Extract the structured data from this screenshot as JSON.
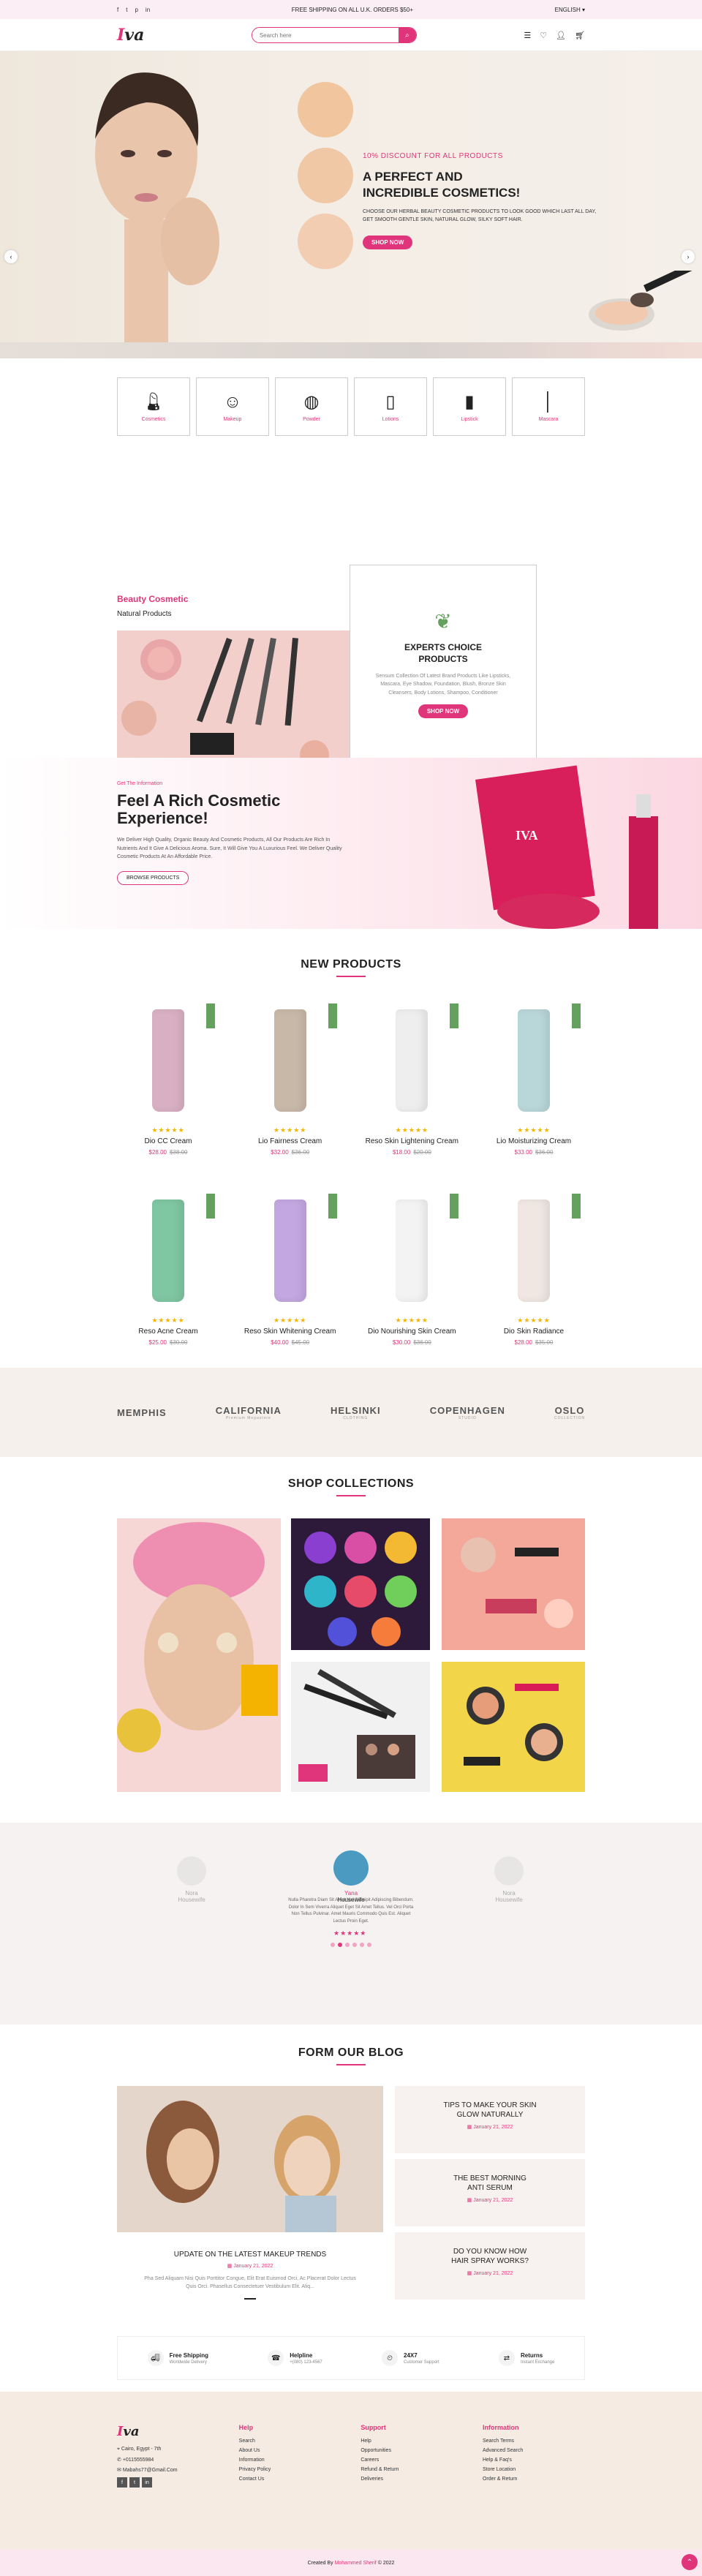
{
  "topbar": {
    "announcement": "FREE SHIPPING ON ALL U.K. ORDERS $50+",
    "language": "ENGLISH",
    "social_icons": [
      "facebook-icon",
      "twitter-icon",
      "pinterest-icon",
      "linkedin-icon"
    ]
  },
  "header": {
    "logo": "Iva",
    "search_placeholder": "Search here",
    "icons": [
      "grid-icon",
      "heart-icon",
      "user-icon",
      "cart-icon"
    ]
  },
  "hero": {
    "subtitle": "10% DISCOUNT FOR ALL PRODUCTS",
    "title_line1": "A PERFECT AND",
    "title_line2": "INCREDIBLE COSMETICS!",
    "text": "CHOOSE OUR HERBAL BEAUTY COSMETIC PRODUCTS TO LOOK GOOD WHICH LAST ALL DAY, GET SMOOTH GENTLE SKIN, NATURAL GLOW, SILKY SOFT HAIR.",
    "button": "SHOP NOW"
  },
  "categories": [
    {
      "label": "Cosmetics",
      "icon": "cosmetics-icon"
    },
    {
      "label": "Makeup",
      "icon": "makeup-icon"
    },
    {
      "label": "Powder",
      "icon": "powder-icon"
    },
    {
      "label": "Lotions",
      "icon": "lotion-icon"
    },
    {
      "label": "Lipstick",
      "icon": "lipstick-icon"
    },
    {
      "label": "Mascara",
      "icon": "mascara-icon"
    }
  ],
  "beauty": {
    "label": "Beauty Cosmetic",
    "sub": "Natural Products",
    "card_title_line1": "EXPERTS CHOICE",
    "card_title_line2": "PRODUCTS",
    "card_text": "Sensum Collection Of Latest Brand Products Like Lipsticks, Mascara, Eye Shadow, Foundation, Blush, Bronze Skin Cleansers, Body Lotions, Shampoo, Conditioner",
    "card_button": "SHOP NOW",
    "prev": "‹",
    "next": "›"
  },
  "banner": {
    "small": "Get The Information",
    "title_line1": "Feel A Rich Cosmetic",
    "title_line2": "Experience!",
    "text": "We Deliver High Quality, Organic Beauty And Cosmetic Products, All Our Products Are Rich In Nutrients And It Give A Delicious Aroma. Sure, It Will Give You A Luxurious Feel. We Deliver Quality Cosmetic Products At An Affordable Price.",
    "button": "BROWSE PRODUCTS",
    "pack_text": "IVA"
  },
  "new_products": {
    "title": "NEW PRODUCTS",
    "items": [
      {
        "name": "Dio CC Cream",
        "price": "$28.00",
        "old": "$38.00",
        "stars": "★★★★★"
      },
      {
        "name": "Lio Fairness Cream",
        "price": "$32.00",
        "old": "$36.00",
        "stars": "★★★★★"
      },
      {
        "name": "Reso Skin Lightening Cream",
        "price": "$18.00",
        "old": "$20.00",
        "stars": "★★★★★"
      },
      {
        "name": "Lio Moisturizing Cream",
        "price": "$33.00",
        "old": "$36.00",
        "stars": "★★★★★"
      },
      {
        "name": "Reso Acne Cream",
        "price": "$25.00",
        "old": "$30.00",
        "stars": "★★★★★"
      },
      {
        "name": "Reso Skin Whitening Cream",
        "price": "$40.00",
        "old": "$45.00",
        "stars": "★★★★★"
      },
      {
        "name": "Dio Nourishing Skin Cream",
        "price": "$30.00",
        "old": "$36.00",
        "stars": "★★★★★"
      },
      {
        "name": "Dio Skin Radiance",
        "price": "$28.00",
        "old": "$35.00",
        "stars": "★★★★★"
      }
    ]
  },
  "brands": [
    {
      "name": "MEMPHIS",
      "sub": ""
    },
    {
      "name": "CALIFORNIA",
      "sub": "Premium Megastore"
    },
    {
      "name": "HELSINKI",
      "sub": "CLOTHING"
    },
    {
      "name": "COPENHAGEN",
      "sub": "STUDIO"
    },
    {
      "name": "OSLO",
      "sub": "COLLECTION"
    }
  ],
  "collections": {
    "title": "SHOP COLLECTIONS"
  },
  "testimonial": {
    "left_name": "Nora",
    "left_role": "Housewife",
    "name": "Yana",
    "role": "Housewife",
    "right_name": "Nora",
    "right_role": "Housewife",
    "quote": "Nulla Pharetra Diam Sit Amet Nisl Suscipit Adipiscing Bibendum. Dolor In Sem Viverra Aliquet Eget Sit Amet Tellus. Vel Orci Porta Non Tellus Pulvinar. Amet Mauris Commodo Quis Est. Aliquet Lectus Proin Eget.",
    "stars": "★★★★★"
  },
  "blog": {
    "title": "FORM OUR BLOG",
    "main_title": "UPDATE ON THE LATEST MAKEUP TRENDS",
    "main_date": "January 21, 2022",
    "main_text": "Pha Sed Aliquam Nisi Quis Porttitor Congue, Elit Erat Euismod Orci, Ac Placerat Dolor Lectus Quis Orci. Phasellus Consectetuer Vestibulum Elit. Aliq...",
    "side": [
      {
        "title_line1": "TIPS TO MAKE YOUR SKIN",
        "title_line2": "GLOW NATURALLY",
        "date": "January 21, 2022"
      },
      {
        "title_line1": "THE BEST MORNING",
        "title_line2": "ANTI SERUM",
        "date": "January 21, 2022"
      },
      {
        "title_line1": "DO YOU KNOW HOW",
        "title_line2": "HAIR SPRAY WORKS?",
        "date": "January 21, 2022"
      }
    ]
  },
  "services": [
    {
      "title": "Free Shipping",
      "sub": "Worldwide Delivery",
      "icon": "truck-icon"
    },
    {
      "title": "Helpline",
      "sub": "+(080) 123-4567",
      "icon": "phone-icon"
    },
    {
      "title": "24X7",
      "sub": "Customer Support",
      "icon": "headset-icon"
    },
    {
      "title": "Returns",
      "sub": "Instant Exchange",
      "icon": "exchange-icon"
    }
  ],
  "footer": {
    "logo": "Iva",
    "address": "Cairo, Egypt - 7th",
    "phone": "+0115555984",
    "email": "Mabahs77@Gmail.Com",
    "help_title": "Help",
    "help": [
      "Search",
      "About Us",
      "Information",
      "Privacy Policy",
      "Contact Us"
    ],
    "support_title": "Support",
    "support": [
      "Help",
      "Opportunities",
      "Careers",
      "Refund & Return",
      "Deliveries"
    ],
    "info_title": "Information",
    "info": [
      "Search Terms",
      "Advanced Search",
      "Help & Faq's",
      "Store Location",
      "Order & Return"
    ],
    "copyright_pre": "Created By",
    "copyright_name": "Mohammed Sherif",
    "copyright_post": "© 2022"
  },
  "colors": {
    "accent": "#e0357a",
    "green_tag": "#64a05e",
    "star": "#f4b400"
  }
}
